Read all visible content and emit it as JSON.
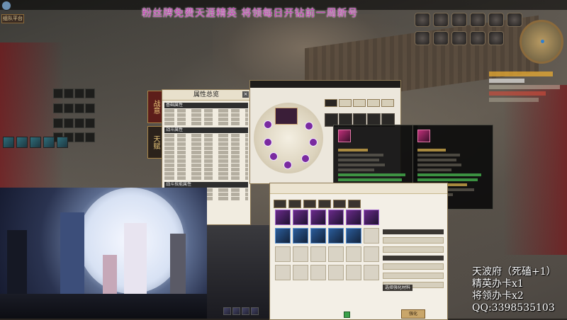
{
  "banner": "粉丝牌免费天涯精英 将领每日开钻前一周新号",
  "team_button": "组队平台",
  "attribute_panel": {
    "title": "属性总览",
    "tabs": [
      "战意",
      "天赋"
    ],
    "sections": [
      "基础属性",
      "战斗属性",
      "战斗技能属性"
    ]
  },
  "overlay_lines": [
    "天波府（死磕+1）",
    "精英办卡x1",
    "将领办卡x2",
    "QQ:3398535103"
  ],
  "refine": {
    "section_label": "选择强化材料",
    "button": "强化"
  },
  "colors": {
    "banner": "#c23fb3",
    "overlay_text": "#ffffff",
    "accent_gold": "#c9a66a"
  }
}
